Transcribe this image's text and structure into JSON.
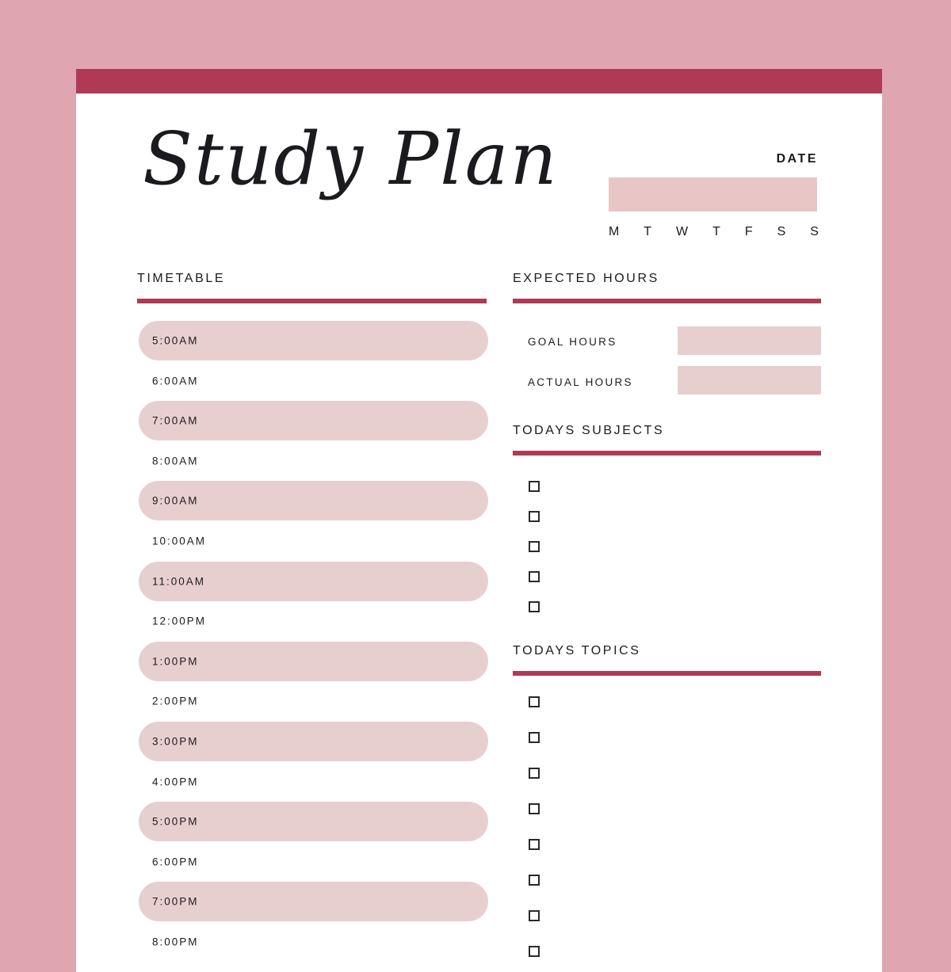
{
  "colors": {
    "background": "#dfa6b0",
    "accent": "#b03a53",
    "field_fill": "#e8cfcf",
    "date_fill": "#e8c6c6"
  },
  "header": {
    "title": "Study Plan",
    "date_label": "DATE",
    "days": [
      "M",
      "T",
      "W",
      "T",
      "F",
      "S",
      "S"
    ]
  },
  "timetable": {
    "title": "TIMETABLE",
    "slots": [
      {
        "time": "5:00AM",
        "filled": true
      },
      {
        "time": "6:00AM",
        "filled": false
      },
      {
        "time": "7:00AM",
        "filled": true
      },
      {
        "time": "8:00AM",
        "filled": false
      },
      {
        "time": "9:00AM",
        "filled": true
      },
      {
        "time": "10:00AM",
        "filled": false
      },
      {
        "time": "11:00AM",
        "filled": true
      },
      {
        "time": "12:00PM",
        "filled": false
      },
      {
        "time": "1:00PM",
        "filled": true
      },
      {
        "time": "2:00PM",
        "filled": false
      },
      {
        "time": "3:00PM",
        "filled": true
      },
      {
        "time": "4:00PM",
        "filled": false
      },
      {
        "time": "5:00PM",
        "filled": true
      },
      {
        "time": "6:00PM",
        "filled": false
      },
      {
        "time": "7:00PM",
        "filled": true
      },
      {
        "time": "8:00PM",
        "filled": false
      }
    ]
  },
  "expected_hours": {
    "title": "EXPECTED HOURS",
    "goal_label": "GOAL HOURS",
    "goal_value": "",
    "actual_label": "ACTUAL HOURS",
    "actual_value": ""
  },
  "subjects": {
    "title": "TODAYS SUBJECTS",
    "items": [
      "",
      "",
      "",
      "",
      ""
    ]
  },
  "topics": {
    "title": "TODAYS TOPICS",
    "items": [
      "",
      "",
      "",
      "",
      "",
      "",
      "",
      ""
    ]
  }
}
